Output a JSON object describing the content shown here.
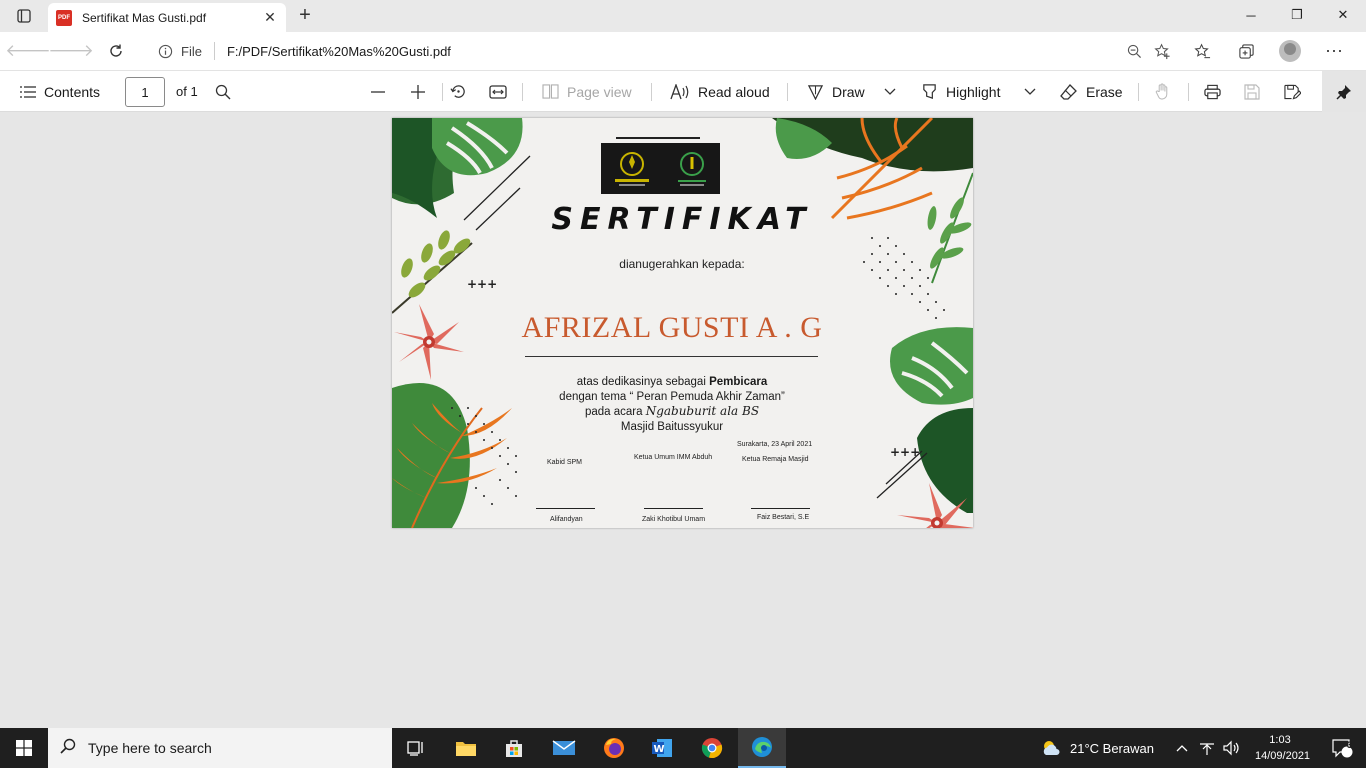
{
  "tab": {
    "title": "Sertifikat Mas Gusti.pdf",
    "icon_label": "PDF"
  },
  "address": {
    "scheme_label": "File",
    "url": "F:/PDF/Sertifikat%20Mas%20Gusti.pdf"
  },
  "pdf_toolbar": {
    "contents_label": "Contents",
    "page_number": "1",
    "page_total": "of 1",
    "page_view_label": "Page view",
    "read_aloud_label": "Read aloud",
    "draw_label": "Draw",
    "highlight_label": "Highlight",
    "erase_label": "Erase"
  },
  "certificate": {
    "title": "SERTIFIKAT",
    "awarded_to": "dianugerahkan kepada:",
    "recipient": "AFRIZAL GUSTI A . G",
    "line1_prefix": "atas dedikasinya sebagai ",
    "line1_role": "Pembicara",
    "line2": "dengan tema “ Peran Pemuda Akhir Zaman”",
    "line3_prefix": "pada acara ",
    "line3_event": "Ngabuburit ala BS",
    "line4": "Masjid Baitussyukur",
    "place_date": "Surakarta, 23 April 2021",
    "signers": [
      {
        "role": "Kabid SPM",
        "name": "Alifandyan"
      },
      {
        "role": "Ketua Umum IMM Abduh",
        "name": "Zaki Khotibul Umam"
      },
      {
        "role": "Ketua Remaja Masjid",
        "name": "Faiz Bestari, S.E"
      }
    ]
  },
  "taskbar": {
    "search_placeholder": "Type here to search",
    "weather": "21°C  Berawan",
    "time": "1:03",
    "date": "14/09/2021",
    "notification_count": "3"
  },
  "colors": {
    "accent_orange": "#c85a2e",
    "leaf_green": "#3f8a3b",
    "taskbar": "#1f1f1f"
  }
}
